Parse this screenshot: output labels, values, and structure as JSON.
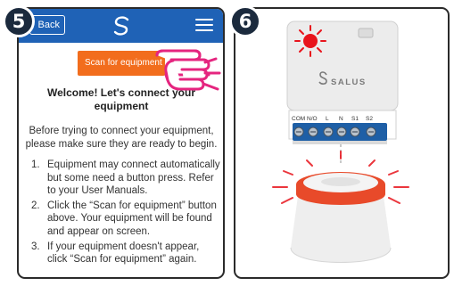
{
  "step_badges": {
    "left": "5",
    "right": "6"
  },
  "app": {
    "back_label": "Back",
    "logo_icon": "salus-swirl-icon",
    "menu_icon": "hamburger-menu-icon",
    "colors": {
      "header": "#1f62b6",
      "accent": "#f26d1d"
    }
  },
  "scan_button_label": "Scan for equipment",
  "welcome_title": "Welcome! Let's connect your equipment",
  "intro_text": "Before trying to connect your equipment, please make sure they are ready to begin.",
  "steps": [
    {
      "num": "1.",
      "text": "Equipment may connect automatically but some need a button press. Refer to your User Manuals."
    },
    {
      "num": "2.",
      "text": "Click the “Scan for equipment” button above. Your equipment will be found and appear on screen."
    },
    {
      "num": "3.",
      "text": "If your equipment doesn't appear, click “Scan for equipment” again."
    }
  ],
  "device": {
    "brand": "SALUS",
    "terminals": [
      "COM",
      "N/O",
      "L",
      "N",
      "S1",
      "S2"
    ],
    "led_color": "#e8141c",
    "ring_color": "#e84a2a"
  }
}
